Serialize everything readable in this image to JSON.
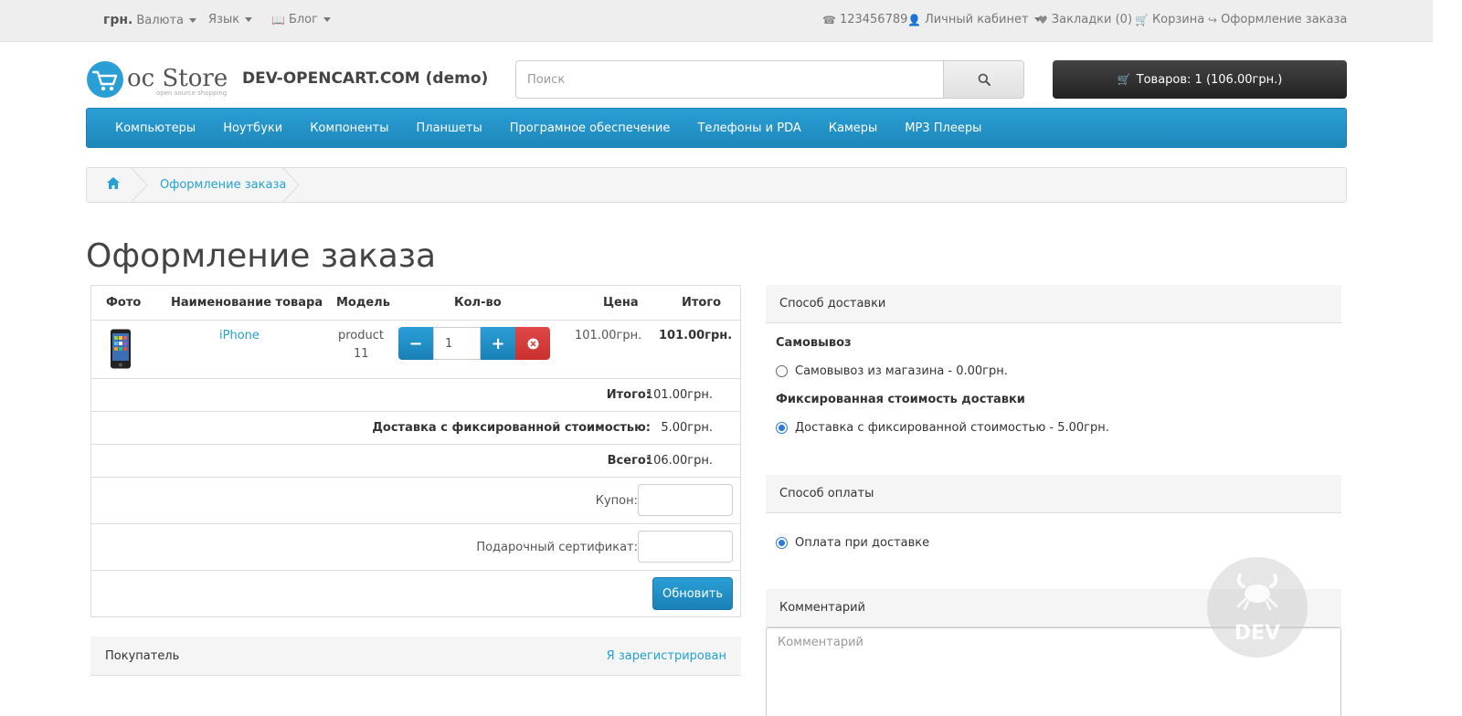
{
  "topbar": {
    "currency_symbol": "грн.",
    "currency_label": "Валюта",
    "language_label": "Язык",
    "blog_label": "Блог",
    "phone": "123456789",
    "account_label": "Личный кабинет",
    "wishlist_label": "Закладки (0)",
    "cart_label": "Корзина",
    "checkout_label": "Оформление заказа"
  },
  "header": {
    "logo_text": "oc Store",
    "logo_tagline": "open source shopping",
    "site_name": "DEV-OPENCART.COM (demo)",
    "search_placeholder": "Поиск",
    "cart_button": "Товаров: 1 (106.00грн.)"
  },
  "menu": [
    "Компьютеры",
    "Ноутбуки",
    "Компоненты",
    "Планшеты",
    "Програмное обеспечение",
    "Телефоны и PDA",
    "Камеры",
    "MP3 Плееры"
  ],
  "breadcrumb": {
    "current": "Оформление заказа"
  },
  "page_title": "Оформление заказа",
  "cart": {
    "headers": {
      "photo": "Фото",
      "name": "Наименование товара",
      "model": "Модель",
      "qty": "Кол-во",
      "price": "Цена",
      "total": "Итого"
    },
    "product": {
      "name": "iPhone",
      "model_line1": "product",
      "model_line2": "11",
      "qty": "1",
      "price": "101.00грн.",
      "total": "101.00грн."
    },
    "subtotal": {
      "label": "Итого:",
      "value": "101.00грн."
    },
    "shipping": {
      "label": "Доставка с фиксированной стоимостью:",
      "value": "5.00грн."
    },
    "grand_total": {
      "label": "Всего:",
      "value": "106.00грн."
    },
    "coupon_label": "Купон:",
    "voucher_label": "Подарочный сертификат:",
    "update_button": "Обновить"
  },
  "shipping_panel": {
    "title": "Способ доставки",
    "group1": "Самовывоз",
    "option1": "Самовывоз из магазина - 0.00грн.",
    "group2": "Фиксированная стоимость доставки",
    "option2": "Доставка с фиксированной стоимостью - 5.00грн."
  },
  "payment_panel": {
    "title": "Способ оплаты",
    "option1": "Оплата при доставке"
  },
  "comment_panel": {
    "title": "Комментарий",
    "placeholder": "Комментарий"
  },
  "customer_panel": {
    "title": "Покупатель",
    "login_link": "Я зарегистрирован"
  },
  "watermark": "DEV",
  "colors": {
    "accent": "#23a1d1",
    "menu": "#229ac8",
    "cart_button": "#333333",
    "danger": "#d9534f"
  }
}
